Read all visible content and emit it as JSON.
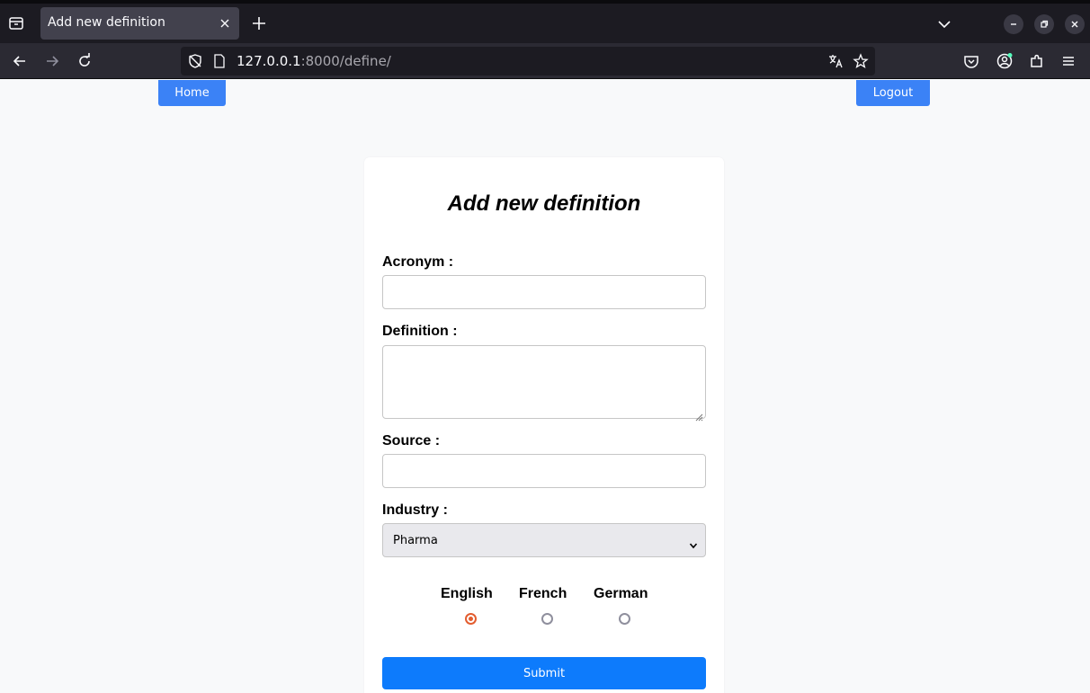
{
  "browser": {
    "tab_title": "Add new definition",
    "url_host": "127.0.0.1",
    "url_rest": ":8000/define/",
    "icons": [
      "tab-list-icon",
      "close-icon",
      "plus-icon",
      "chevron-down-icon",
      "minimize-icon",
      "restore-icon",
      "close-window-icon",
      "back-icon",
      "forward-icon",
      "reload-icon",
      "tracking-shield-icon",
      "page-icon",
      "translate-icon",
      "star-icon",
      "pocket-icon",
      "account-icon",
      "extensions-icon",
      "menu-icon"
    ]
  },
  "nav": {
    "home_label": "Home",
    "logout_label": "Logout"
  },
  "form": {
    "title": "Add new definition",
    "acronym_label": "Acronym :",
    "acronym_value": "",
    "definition_label": "Definition :",
    "definition_value": "",
    "source_label": "Source :",
    "source_value": "",
    "industry_label": "Industry :",
    "industry_selected": "Pharma",
    "languages": [
      {
        "label": "English",
        "checked": true
      },
      {
        "label": "French",
        "checked": false
      },
      {
        "label": "German",
        "checked": false
      }
    ],
    "submit_label": "Submit"
  },
  "colors": {
    "nav_button": "#3b82f6",
    "submit_button": "#0d7bfc",
    "radio_checked": "#e35d2f",
    "page_background": "#f8f9fa"
  }
}
